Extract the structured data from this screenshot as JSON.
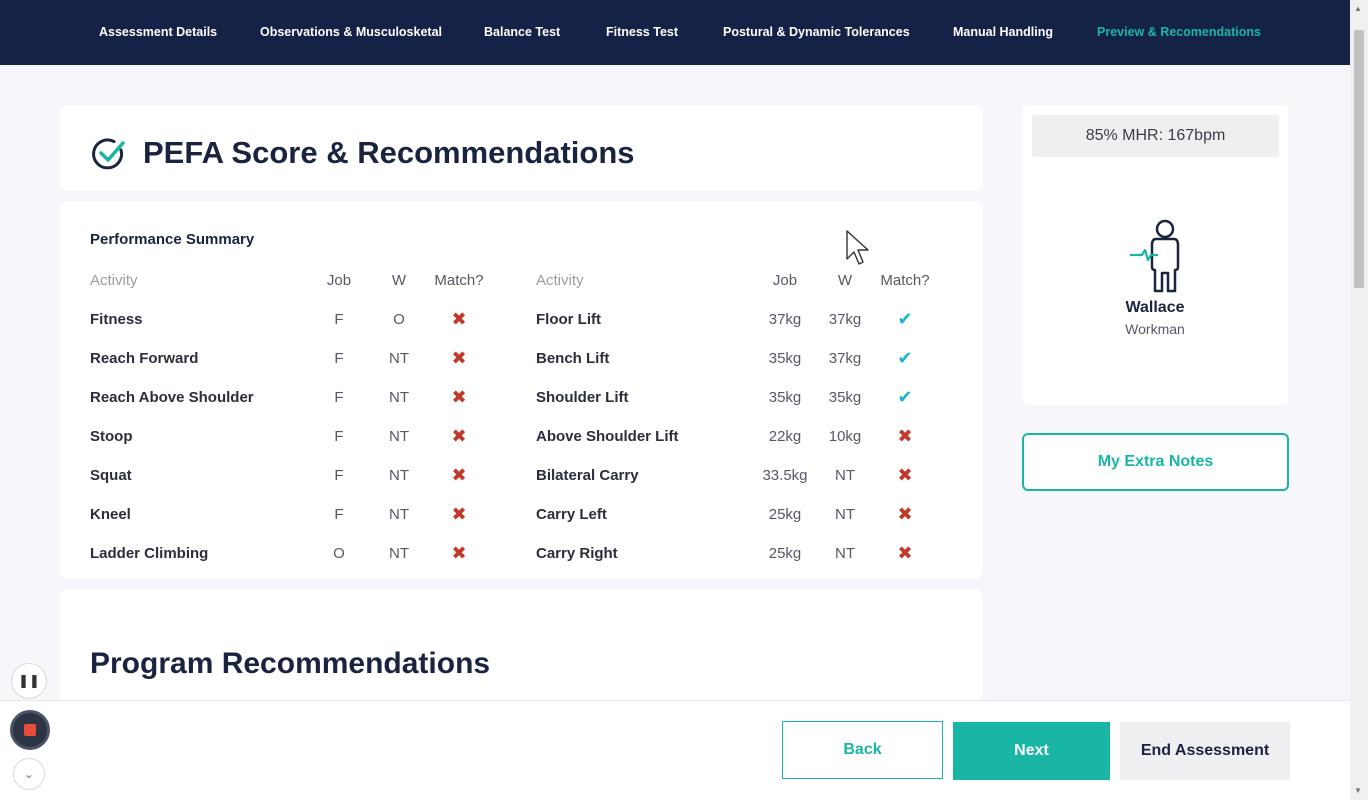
{
  "nav": {
    "tabs": [
      {
        "label": "Assessment Details"
      },
      {
        "label": "Observations & Musculosketal"
      },
      {
        "label": "Balance Test"
      },
      {
        "label": "Fitness Test"
      },
      {
        "label": "Postural & Dynamic Tolerances"
      },
      {
        "label": "Manual Handling"
      },
      {
        "label": "Preview & Recomendations",
        "active": true
      }
    ]
  },
  "title": "PEFA Score & Recommendations",
  "summary": {
    "heading": "Performance Summary",
    "headers": {
      "activity": "Activity",
      "job": "Job",
      "w": "W",
      "match": "Match?"
    },
    "left": [
      {
        "activity": "Fitness",
        "job": "F",
        "w": "O",
        "match": "✖"
      },
      {
        "activity": "Reach Forward",
        "job": "F",
        "w": "NT",
        "match": "✖"
      },
      {
        "activity": "Reach Above Shoulder",
        "job": "F",
        "w": "NT",
        "match": "✖"
      },
      {
        "activity": "Stoop",
        "job": "F",
        "w": "NT",
        "match": "✖"
      },
      {
        "activity": "Squat",
        "job": "F",
        "w": "NT",
        "match": "✖"
      },
      {
        "activity": "Kneel",
        "job": "F",
        "w": "NT",
        "match": "✖"
      },
      {
        "activity": "Ladder Climbing",
        "job": "O",
        "w": "NT",
        "match": "✖"
      }
    ],
    "right": [
      {
        "activity": "Floor Lift",
        "job": "37kg",
        "w": "37kg",
        "match": "✔"
      },
      {
        "activity": "Bench Lift",
        "job": "35kg",
        "w": "37kg",
        "match": "✔"
      },
      {
        "activity": "Shoulder Lift",
        "job": "35kg",
        "w": "35kg",
        "match": "✔"
      },
      {
        "activity": "Above Shoulder Lift",
        "job": "22kg",
        "w": "10kg",
        "match": "✖"
      },
      {
        "activity": "Bilateral Carry",
        "job": "33.5kg",
        "w": "NT",
        "match": "✖"
      },
      {
        "activity": "Carry Left",
        "job": "25kg",
        "w": "NT",
        "match": "✖"
      },
      {
        "activity": "Carry Right",
        "job": "25kg",
        "w": "NT",
        "match": "✖"
      }
    ]
  },
  "program": {
    "heading": "Program Recommendations"
  },
  "profile": {
    "mhr": "85% MHR: 167bpm",
    "name": "Wallace",
    "role": "Workman"
  },
  "notes_label": "My Extra Notes",
  "footer": {
    "back": "Back",
    "next": "Next",
    "end": "End Assessment"
  },
  "controls": {
    "pause_glyph": "❚❚",
    "down_glyph": "⌄"
  },
  "icons": {
    "check": "check-circle-icon",
    "avatar": "person-heartbeat-icon",
    "cursor": "mouse-pointer-icon"
  },
  "colors": {
    "nav_bg": "#152248",
    "accent": "#19b6a6",
    "fail": "#c0392b",
    "pass": "#19b6cc",
    "text": "#1a2340"
  }
}
